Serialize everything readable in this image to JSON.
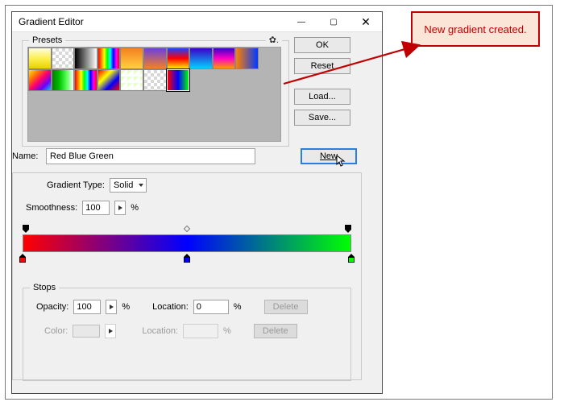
{
  "window": {
    "title": "Gradient Editor"
  },
  "presets": {
    "legend": "Presets",
    "swatches": [
      "linear-gradient(to bottom,#fffde0,#fcf050,#e8d000)",
      "checker",
      "linear-gradient(to right,#000,#fff)",
      "linear-gradient(to right,#f00,#ff8000,#ff0,#0f0,#0ff,#00f,#f0f,#f00)",
      "linear-gradient(to bottom,#f58020,#ffd040)",
      "linear-gradient(to bottom,#6b3fe0,#f58020)",
      "linear-gradient(to bottom,#2040ff,#f00,#ffea00)",
      "linear-gradient(to bottom,#3a00c8,#00d2ff)",
      "linear-gradient(to bottom,#3a00c8,#ff00c8,#ff9a00)",
      "linear-gradient(to right,#ff8000,#0038ff)",
      "linear-gradient(135deg,#ffe030,#ff7a00,#ff006a,#6a00ff,#00c8ff)",
      "linear-gradient(to right,#007c00,#00c000,#53ff53,#ffffff)",
      "linear-gradient(to right,#f00,#ff8000,#ff0,#0f0,#0ff,#00f,#f0f,#f00)",
      "linear-gradient(135deg,#f00,#ff0,#00f,#f00)",
      "linear-gradient(135deg,#e6ffc8 40%,transparent 40%),checker",
      "checker",
      "linear-gradient(to right,#f00,#00f,#0f0)"
    ]
  },
  "side": {
    "ok": "OK",
    "reset": "Reset",
    "load": "Load...",
    "save": "Save..."
  },
  "name": {
    "label": "Name:",
    "value": "Red Blue Green",
    "new": "New"
  },
  "gradType": {
    "label": "Gradient Type:",
    "value": "Solid"
  },
  "smooth": {
    "label": "Smoothness:",
    "value": "100",
    "pct": "%"
  },
  "gradient": {
    "hex": "linear-gradient(to right,#ff0000,#0000ff,#00ff00)",
    "stops": [
      {
        "pos": 0,
        "color": "#ff0000"
      },
      {
        "pos": 50,
        "color": "#0000ff"
      },
      {
        "pos": 100,
        "color": "#00ff00"
      }
    ],
    "opacityStops": [
      {
        "pos": 0
      },
      {
        "pos": 100
      }
    ],
    "diamond": 50
  },
  "stops": {
    "legend": "Stops",
    "opacity": "Opacity:",
    "opVal": "100",
    "pct": "%",
    "location": "Location:",
    "locVal": "0",
    "delete": "Delete",
    "color": "Color:"
  },
  "callout": "New gradient created."
}
